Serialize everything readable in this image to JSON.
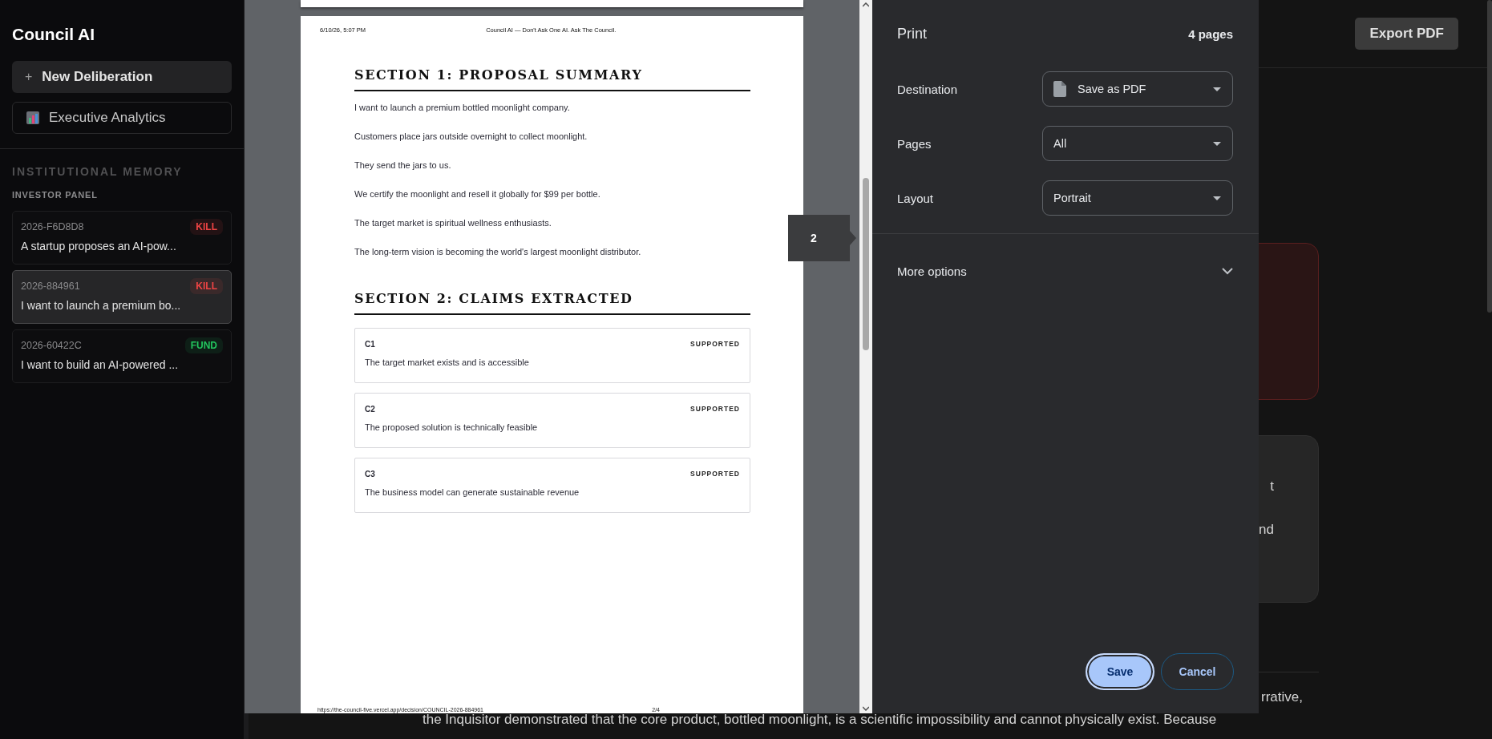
{
  "sidebar": {
    "title": "Council AI",
    "new_button": {
      "icon": "+",
      "label": "New Deliberation"
    },
    "analytics_button": {
      "label": "Executive Analytics"
    },
    "section_title": "INSTITUTIONAL MEMORY",
    "group_title": "INVESTOR PANEL",
    "decisions": [
      {
        "id": "2026-F6D8D8",
        "verdict": "KILL",
        "color": "#ef4444",
        "summary": "A startup proposes an AI-pow...",
        "selected": false
      },
      {
        "id": "2026-884961",
        "verdict": "KILL",
        "color": "#ef4444",
        "summary": "I want to launch a premium bo...",
        "selected": true
      },
      {
        "id": "2026-60422C",
        "verdict": "FUND",
        "color": "#22c55e",
        "summary": "I want to build an AI-powered ...",
        "selected": false
      }
    ]
  },
  "top_bar": {
    "export_button": "Export PDF"
  },
  "main": {
    "card_fragments": [
      "t",
      "nd"
    ],
    "paragraph_fragment": "rrative,",
    "paragraph_line": "the Inquisitor demonstrated that the core product, bottled moonlight, is a scientific impossibility and cannot physically exist. Because"
  },
  "print_dialog": {
    "title": "Print",
    "page_count": "4 pages",
    "settings": [
      {
        "label": "Destination",
        "value": "Save as PDF",
        "kind": "destination"
      },
      {
        "label": "Pages",
        "value": "All",
        "kind": "plain"
      },
      {
        "label": "Layout",
        "value": "Portrait",
        "kind": "plain"
      }
    ],
    "more_options": "More options",
    "expanded": false,
    "buttons": [
      {
        "label": "Save",
        "kind": "primary"
      },
      {
        "label": "Cancel",
        "kind": "secondary"
      }
    ],
    "preview": {
      "page_indicator": "2",
      "header_date": "6/10/26, 5:07 PM",
      "header_title": "Council AI — Don't Ask One AI. Ask The Council.",
      "sections": [
        {
          "title": "SECTION 1: PROPOSAL SUMMARY",
          "paragraphs": [
            "I want to launch a premium bottled moonlight company.",
            "Customers place jars outside overnight to collect moonlight.",
            "They send the jars to us.",
            "We certify the moonlight and resell it globally for $99 per bottle.",
            "The target market is spiritual wellness enthusiasts.",
            "The long-term vision is becoming the world's largest moonlight distributor."
          ]
        },
        {
          "title": "SECTION 2: CLAIMS EXTRACTED",
          "claims": [
            {
              "id": "C1",
              "status": "SUPPORTED",
              "text": "The target market exists and is accessible"
            },
            {
              "id": "C2",
              "status": "SUPPORTED",
              "text": "The proposed solution is technically feasible"
            },
            {
              "id": "C3",
              "status": "SUPPORTED",
              "text": "The business model can generate sustainable revenue"
            }
          ]
        }
      ],
      "footer_url": "https://the-council-five.vercel.app/decision/COUNCIL-2026-884961",
      "footer_page": "2/4"
    }
  }
}
